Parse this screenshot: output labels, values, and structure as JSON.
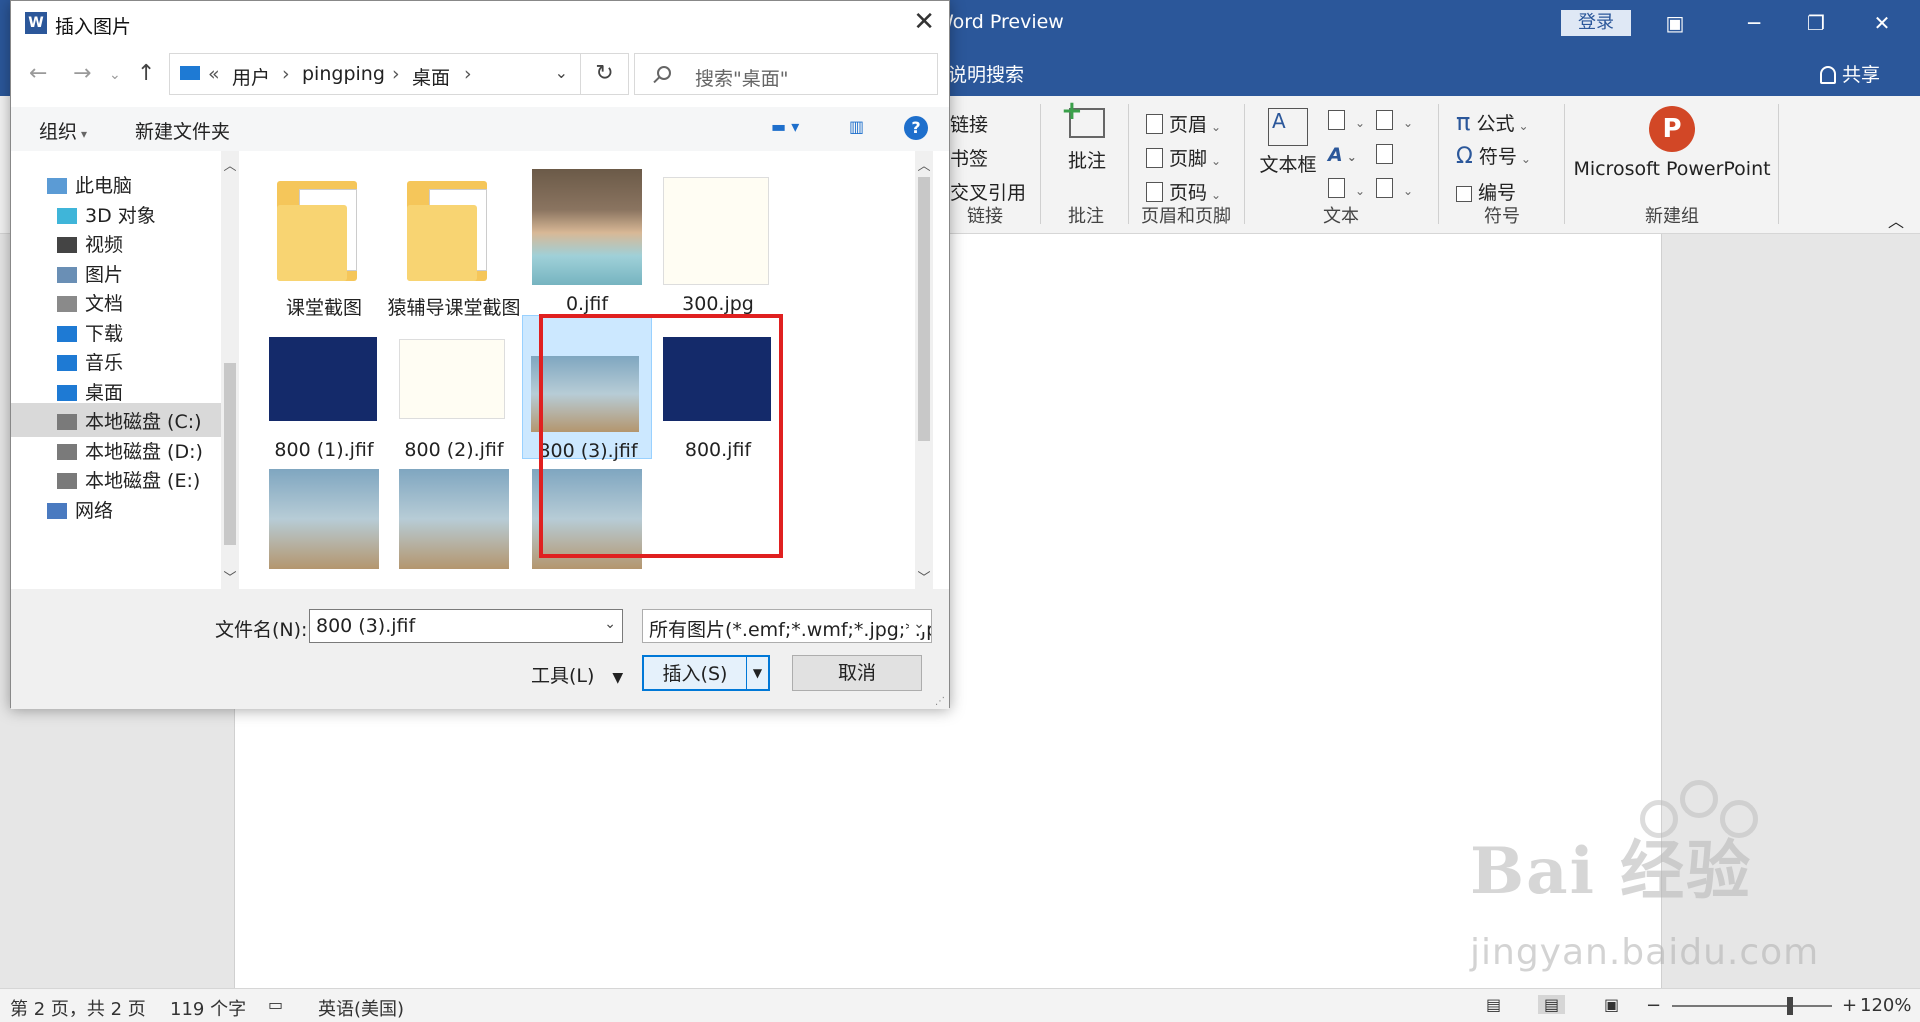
{
  "word": {
    "title": "Word Preview",
    "login": "登录",
    "tell_me": "说明搜索",
    "share": "共享",
    "ribbon": {
      "links": {
        "items": [
          "链接",
          "书签",
          "交叉引用"
        ],
        "label": "链接"
      },
      "comments": {
        "button": "批注",
        "label": "批注"
      },
      "header_footer": {
        "items": [
          "页眉",
          "页脚",
          "页码"
        ],
        "label": "页眉和页脚"
      },
      "text": {
        "textbox": "文本框",
        "label": "文本"
      },
      "symbols": {
        "items": [
          "公式",
          "符号",
          "编号"
        ],
        "label": "符号"
      },
      "new_group": {
        "button": "Microsoft PowerPoint",
        "label": "新建组"
      }
    },
    "status": {
      "page": "第 2 页，共 2 页",
      "words": "119 个字",
      "language": "英语(美国)",
      "zoom": "120%",
      "zoom_level": 0.74
    }
  },
  "dialog": {
    "title": "插入图片",
    "breadcrumb": [
      "用户",
      "pingping",
      "桌面"
    ],
    "breadcrumb_prefix": "«",
    "search_placeholder": "搜索\"桌面\"",
    "toolbar": {
      "organize": "组织",
      "new_folder": "新建文件夹",
      "help": "?"
    },
    "nav_tree": [
      {
        "label": "此电脑",
        "icon": "pc-icon",
        "indent": 1
      },
      {
        "label": "3D 对象",
        "icon": "3d-objects-icon",
        "indent": 2
      },
      {
        "label": "视频",
        "icon": "video-icon",
        "indent": 2
      },
      {
        "label": "图片",
        "icon": "pictures-icon",
        "indent": 2
      },
      {
        "label": "文档",
        "icon": "documents-icon",
        "indent": 2
      },
      {
        "label": "下载",
        "icon": "download-icon",
        "indent": 2
      },
      {
        "label": "音乐",
        "icon": "music-icon",
        "indent": 2
      },
      {
        "label": "桌面",
        "icon": "desktop-icon",
        "indent": 2
      },
      {
        "label": "本地磁盘 (C:)",
        "icon": "drive-icon",
        "indent": 2,
        "selected": true
      },
      {
        "label": "本地磁盘 (D:)",
        "icon": "drive-icon",
        "indent": 2
      },
      {
        "label": "本地磁盘 (E:)",
        "icon": "drive-icon",
        "indent": 2
      },
      {
        "label": "网络",
        "icon": "network-icon",
        "indent": 1
      }
    ],
    "files": [
      {
        "name": "课堂截图",
        "kind": "folder"
      },
      {
        "name": "猿辅导课堂截图",
        "kind": "folder"
      },
      {
        "name": "0.jfif",
        "kind": "image-person"
      },
      {
        "name": "300.jpg",
        "kind": "image-doc"
      },
      {
        "name": "800 (1).jfif",
        "kind": "image-blue"
      },
      {
        "name": "800 (2).jfif",
        "kind": "image-doc2"
      },
      {
        "name": "800 (3).jfif",
        "kind": "image-monster",
        "selected": true
      },
      {
        "name": "800.jfif",
        "kind": "image-blue2"
      },
      {
        "name": "",
        "kind": "image-partial1"
      },
      {
        "name": "",
        "kind": "image-partial2"
      },
      {
        "name": "",
        "kind": "image-partial3"
      }
    ],
    "filename_label": "文件名(N):",
    "filename_value": "800 (3).jfif",
    "filetype_value": "所有图片(*.emf;*.wmf;*.jpg;*.jp",
    "tools": "工具(L)",
    "insert": "插入(S)",
    "cancel": "取消"
  },
  "watermark": {
    "brand": "Bai  经验",
    "url": "jingyan.baidu.com"
  },
  "colors": {
    "word_blue": "#2b579a",
    "selection": "#cce8ff",
    "highlight_box": "#e02020"
  }
}
